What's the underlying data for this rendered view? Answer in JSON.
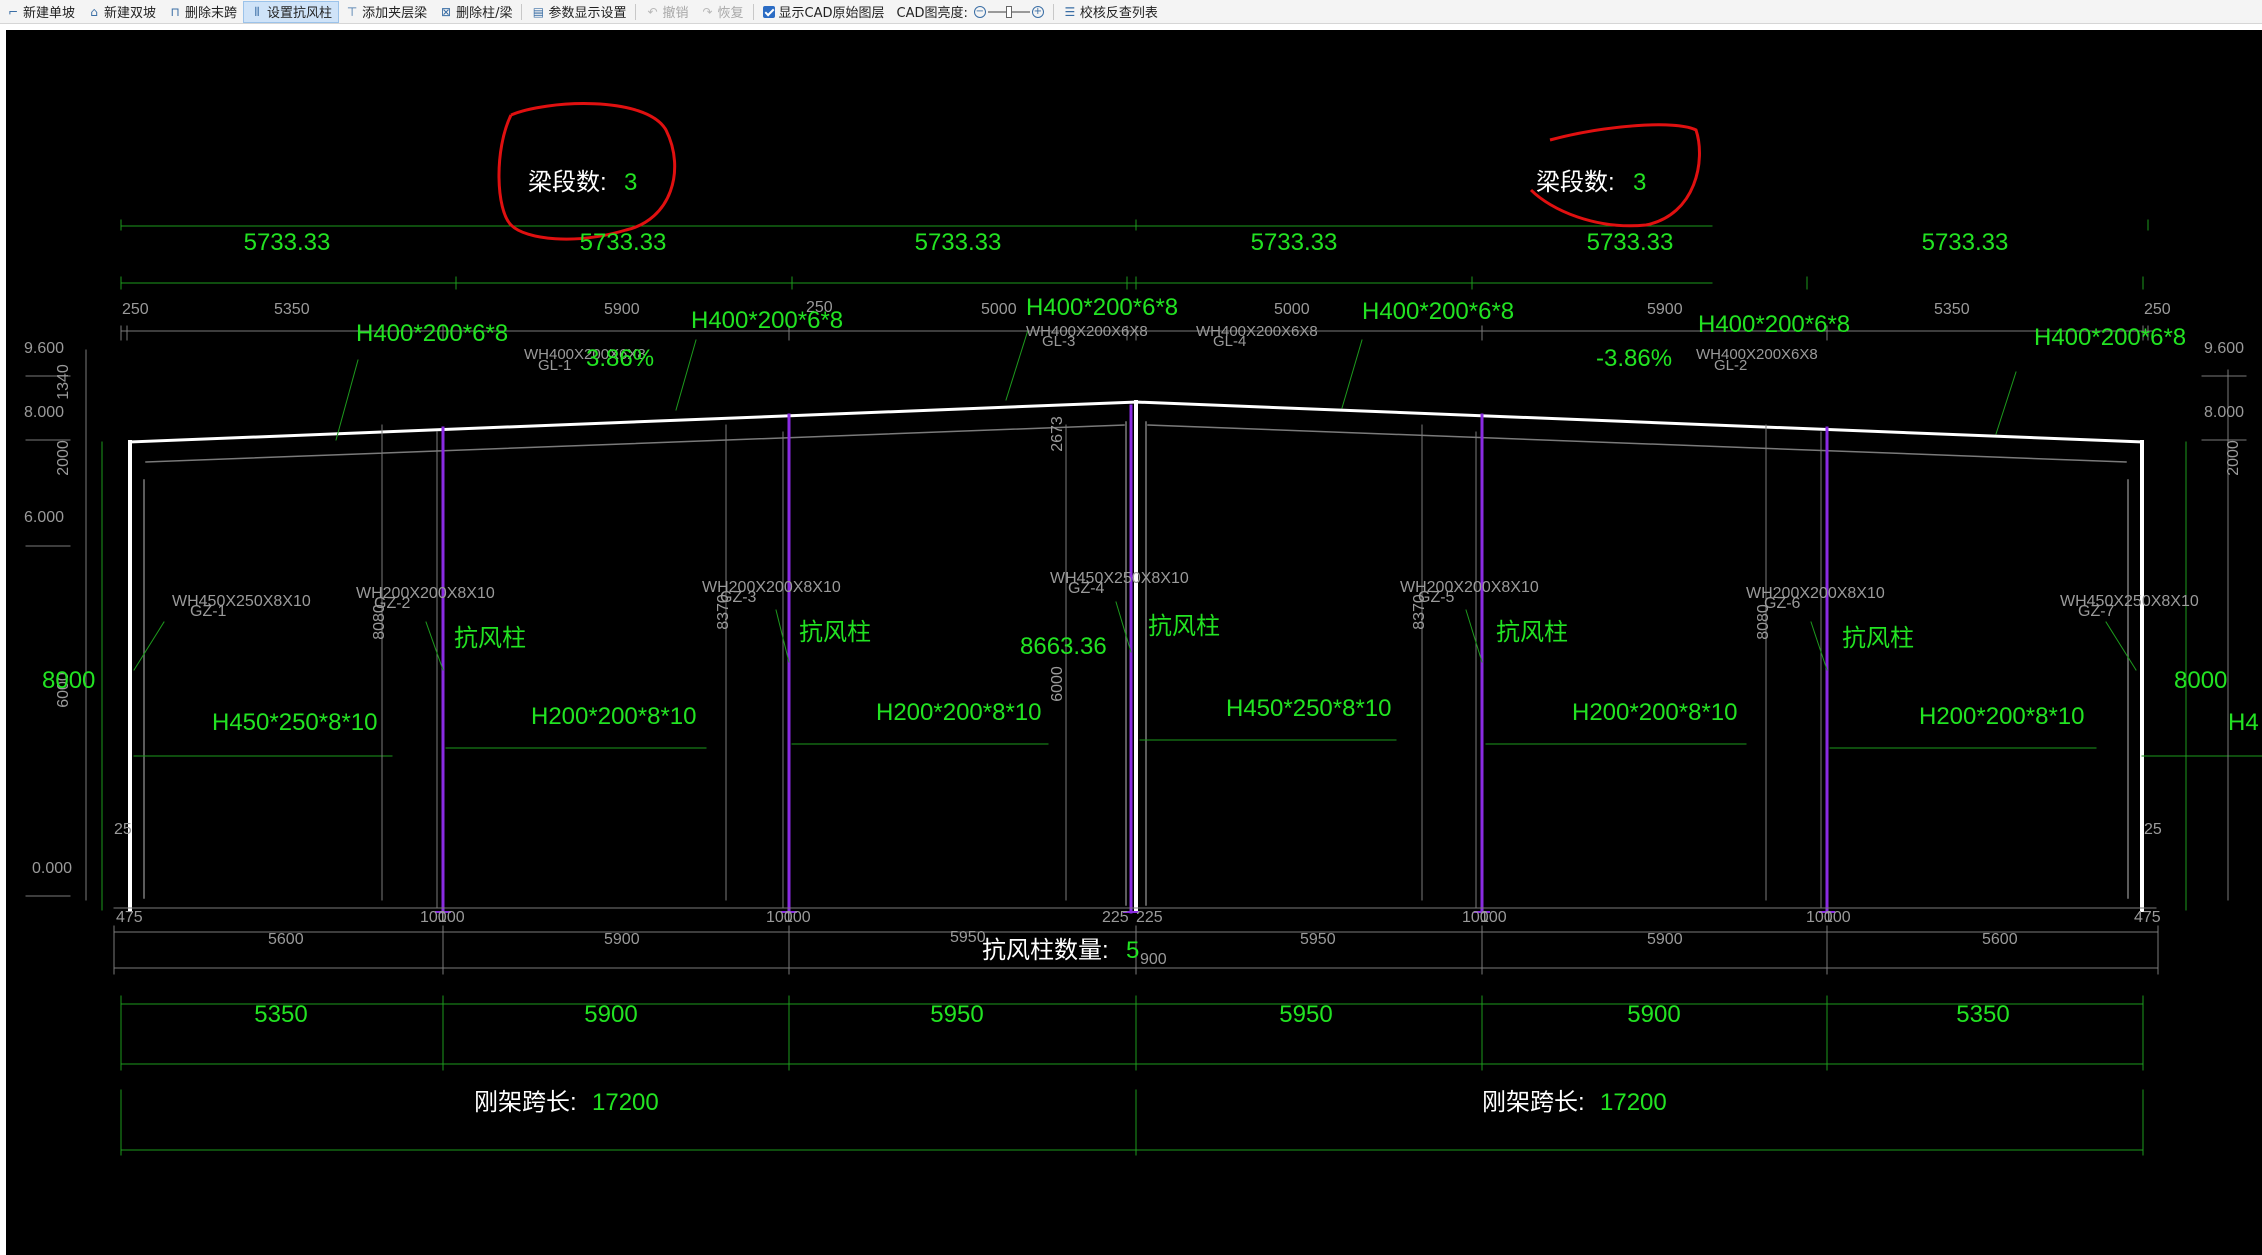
{
  "toolbar": {
    "items": [
      {
        "label": "新建单坡",
        "icon": "single-slope-icon",
        "state": "normal"
      },
      {
        "label": "新建双坡",
        "icon": "double-slope-icon",
        "state": "normal"
      },
      {
        "label": "删除末跨",
        "icon": "delete-span-icon",
        "state": "normal"
      },
      {
        "label": "设置抗风柱",
        "icon": "wind-column-icon",
        "state": "active"
      },
      {
        "label": "添加夹层梁",
        "icon": "mezzanine-beam-icon",
        "state": "normal"
      },
      {
        "label": "删除柱/梁",
        "icon": "delete-column-beam-icon",
        "state": "normal"
      },
      {
        "label": "参数显示设置",
        "icon": "param-display-icon",
        "state": "normal"
      },
      {
        "label": "撤销",
        "icon": "undo-icon",
        "state": "disabled"
      },
      {
        "label": "恢复",
        "icon": "redo-icon",
        "state": "disabled"
      }
    ],
    "show_cad_layer_label": "显示CAD原始图层",
    "show_cad_layer_checked": true,
    "cad_brightness_label": "CAD图亮度:",
    "check_list_label": "校核反查列表"
  },
  "drawing": {
    "segment_count_label": "梁段数:",
    "segment_count_left": "3",
    "segment_count_right": "3",
    "segment_lengths": [
      "5733.33",
      "5733.33",
      "5733.33",
      "5733.33",
      "5733.33",
      "5733.33"
    ],
    "top_dims": [
      "250",
      "5350",
      "5900",
      "250",
      "5000",
      "5000",
      "5900",
      "5350",
      "250"
    ],
    "top_dim_small": "250",
    "slope_left": "3.86%",
    "slope_right": "-3.86%",
    "beam_labels": [
      "H400*200*6*8",
      "H400*200*6*8",
      "H400*200*6*8",
      "H400*200*6*8",
      "H400*200*6*8",
      "H400*200*6*8"
    ],
    "gl_labels": [
      "WH400X200X6X8",
      "GL-1",
      "WH400X200X6X8",
      "GL-3",
      "WH400X200X6X8",
      "GL-4",
      "WH400X200X6X8",
      "GL-2"
    ],
    "elevations": [
      "9.600",
      "8.000",
      "6.000",
      "0.000"
    ],
    "elevations_right": [
      "9.600",
      "8.000"
    ],
    "left_vert_dims": [
      "1340",
      "2000"
    ],
    "right_vert_dim": "2000",
    "height_left": "8000",
    "height_right": "8000",
    "height_center": "8663.36",
    "dim_6000": "6000",
    "dim_2673": "2673",
    "dim_8080": "8080",
    "dim_8370": "8370",
    "wind_column_label": "抗风柱",
    "column_specs": [
      {
        "wh": "WH450X250X8X10",
        "gz": "GZ-1",
        "section": "H450*250*8*10"
      },
      {
        "wh": "WH200X200X8X10",
        "gz": "GZ-2",
        "section": "H200*200*8*10"
      },
      {
        "wh": "WH200X200X8X10",
        "gz": "GZ-3",
        "section": "H200*200*8*10"
      },
      {
        "wh": "WH450X250X8X10",
        "gz": "GZ-4",
        "section": "H450*250*8*10"
      },
      {
        "wh": "WH200X200X8X10",
        "gz": "GZ-5",
        "section": "H200*200*8*10"
      },
      {
        "wh": "WH200X200X8X10",
        "gz": "GZ-6",
        "section": "H200*200*8*10"
      },
      {
        "wh": "WH450X250X8X10",
        "gz": "GZ-7",
        "section": "H4"
      }
    ],
    "dim_25": "25",
    "base_dims": [
      "475",
      "100",
      "100",
      "100",
      "225",
      "225",
      "100",
      "100",
      "100",
      "475"
    ],
    "base_dim_labels": [
      "100",
      "100",
      "100",
      "100",
      "100",
      "100",
      "100",
      "100",
      "100",
      "100"
    ],
    "bottom_small_dims": [
      "5600",
      "5900",
      "5950",
      "5950",
      "5900",
      "5600"
    ],
    "wind_column_count_label": "抗风柱数量:",
    "wind_column_count": "5",
    "wind_count_tail": "900",
    "spans": [
      "5350",
      "5900",
      "5950",
      "5950",
      "5900",
      "5350"
    ],
    "frame_span_label": "刚架跨长:",
    "frame_span_left": "17200",
    "frame_span_right": "17200"
  },
  "colors": {
    "background": "#000000",
    "dim_text": "#22e322",
    "frame": "#ffffff",
    "wind_column": "#8a2be2",
    "annotation": "#e01010",
    "gray": "#9a9a9a"
  }
}
